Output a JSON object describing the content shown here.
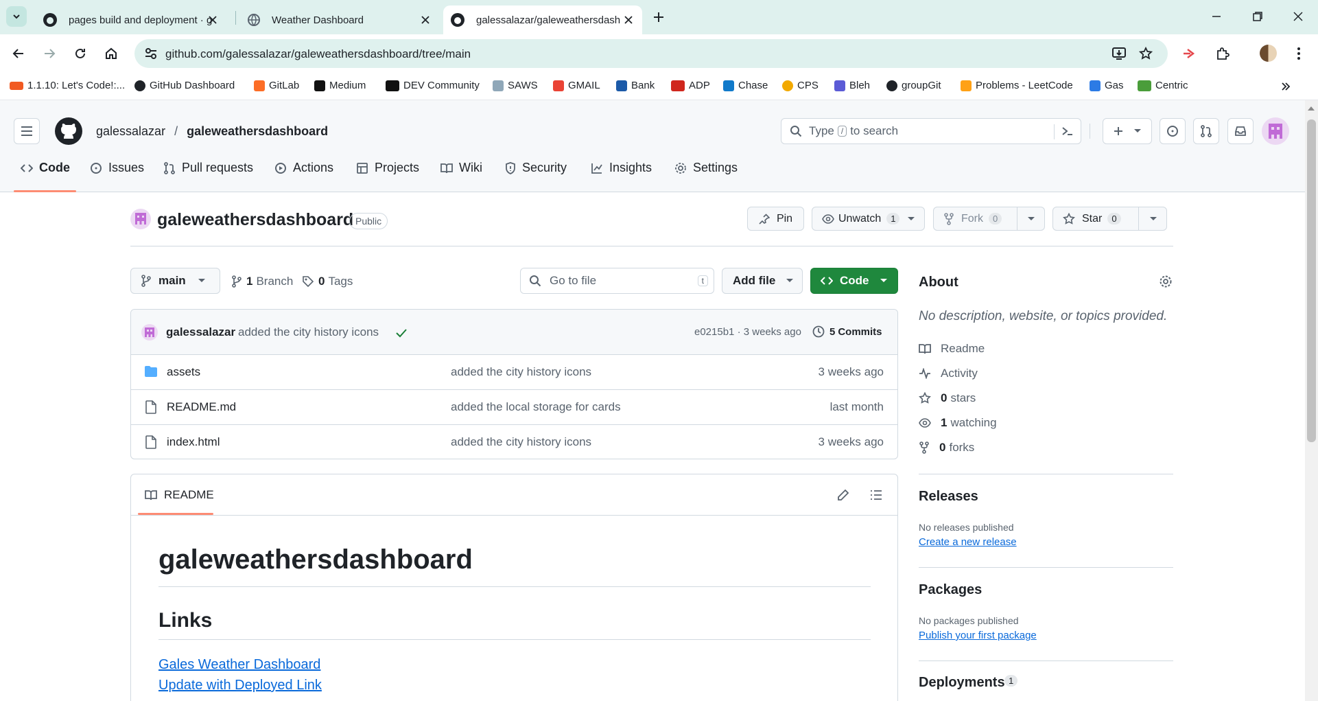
{
  "browser": {
    "tabs": [
      {
        "title": "pages build and deployment · galessalazar/galeweathersdashboard",
        "icon": "github-icon"
      },
      {
        "title": "Weather Dashboard",
        "icon": "globe-icon"
      },
      {
        "title": "galessalazar/galeweathersdashboard",
        "icon": "github-icon"
      }
    ],
    "url": "github.com/galessalazar/galeweathersdashboard/tree/main",
    "bookmarks": [
      "1.1.10: Let's Code!:...",
      "GitHub Dashboard",
      "GitLab",
      "Medium",
      "DEV Community",
      "SAWS",
      "GMAIL",
      "Bank",
      "ADP",
      "Chase",
      "CPS",
      "Bleh",
      "groupGit",
      "Problems - LeetCode",
      "Gas",
      "Centric"
    ]
  },
  "github": {
    "owner": "galessalazar",
    "separator": "/",
    "repo": "galeweathersdashboard",
    "search_placeholder_pre": "Type",
    "search_key": "/",
    "search_placeholder_post": "to search",
    "nav": [
      "Code",
      "Issues",
      "Pull requests",
      "Actions",
      "Projects",
      "Wiki",
      "Security",
      "Insights",
      "Settings"
    ]
  },
  "repo": {
    "name": "galeweathersdashboard",
    "visibility": "Public",
    "pin": "Pin",
    "unwatch": "Unwatch",
    "unwatch_count": "1",
    "fork": "Fork",
    "fork_count": "0",
    "star": "Star",
    "star_count": "0",
    "branch": "main",
    "branches_count": "1",
    "branches_label": "Branch",
    "tags_count": "0",
    "tags_label": "Tags",
    "goto_placeholder": "Go to file",
    "goto_key": "t",
    "add_file": "Add file",
    "code": "Code"
  },
  "commit": {
    "author": "galessalazar",
    "message": "added the city history icons",
    "hash_time": "e0215b1 · 3 weeks ago",
    "commits_count": "5",
    "commits_label": "Commits"
  },
  "files": [
    {
      "name": "assets",
      "type": "folder",
      "message": "added the city history icons",
      "time": "3 weeks ago"
    },
    {
      "name": "README.md",
      "type": "file",
      "message": "added the local storage for cards",
      "time": "last month"
    },
    {
      "name": "index.html",
      "type": "file",
      "message": "added the city history icons",
      "time": "3 weeks ago"
    }
  ],
  "readme": {
    "tab": "README",
    "h1": "galeweathersdashboard",
    "h2": "Links",
    "links": [
      "Gales Weather Dashboard",
      "Update with Deployed Link"
    ]
  },
  "about": {
    "title": "About",
    "desc": "No description, website, or topics provided.",
    "readme": "Readme",
    "activity": "Activity",
    "stars_n": "0",
    "stars_label": "stars",
    "watching_n": "1",
    "watching_label": "watching",
    "forks_n": "0",
    "forks_label": "forks",
    "releases_title": "Releases",
    "releases_none": "No releases published",
    "releases_link": "Create a new release",
    "packages_title": "Packages",
    "packages_none": "No packages published",
    "packages_link": "Publish your first package",
    "deployments_title": "Deployments",
    "deployments_count": "1"
  },
  "colors": {
    "accent": "#fd8c73",
    "green": "#1f883d",
    "link": "#0969da",
    "folder": "#54aeff",
    "avatar": "#c06bd6"
  }
}
